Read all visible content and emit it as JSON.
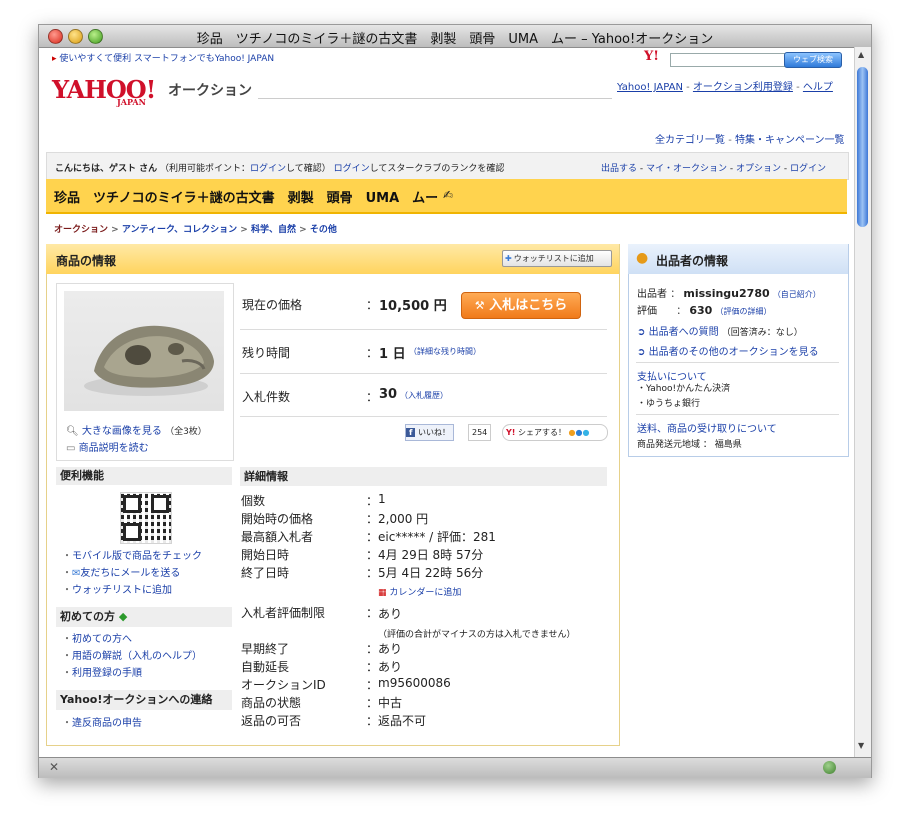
{
  "window": {
    "title": "珍品　ツチノコのミイラ＋謎の古文書　剥製　頭骨　UMA　ムー – Yahoo!オークション"
  },
  "top": {
    "mobile_link": "使いやすくて便利 スマートフォンでもYahoo! JAPAN",
    "search_placeholder": "",
    "search_button": "ウェブ検索",
    "logo_text": "YAHOO!",
    "logo_sub": "JAPAN",
    "brand": "オークション",
    "links": [
      "Yahoo! JAPAN",
      "オークション利用登録",
      "ヘルプ"
    ],
    "category_links": [
      "全カテゴリ一覧",
      "特集・キャンペーン一覧"
    ]
  },
  "userbar": {
    "greeting": "こんにちは、ゲスト さん",
    "points_prefix": "（利用可能ポイント：",
    "points_login": "ログイン",
    "points_suffix": "して確認）",
    "star_login": "ログイン",
    "star_text": "してスタークラブのランクを確認",
    "right_links": [
      "出品する",
      "マイ・オークション",
      "オプション",
      "ログイン"
    ]
  },
  "item_title": "珍品　ツチノコのミイラ＋謎の古文書　剥製　頭骨　UMA　ムー",
  "breadcrumb": [
    "オークション",
    "アンティーク、コレクション",
    "科学、自然",
    "その他"
  ],
  "item_info": {
    "header": "商品の情報",
    "watch_button": "ウォッチリストに追加",
    "image_link": "大きな画像を見る",
    "image_count": "（全3枚）",
    "desc_link": "商品説明を読む",
    "price_label": "現在の価格",
    "price_value": "10,500 円",
    "bid_button": "入札はこちら",
    "time_label": "残り時間",
    "time_value": "1 日",
    "time_detail": "（詳細な残り時間）",
    "bids_label": "入札件数",
    "bids_value": "30",
    "bids_history": "（入札履歴）",
    "like_label": "いいね！",
    "like_count": "254",
    "share_label": "シェアする！"
  },
  "convenience": {
    "header": "便利機能",
    "links": [
      "モバイル版で商品をチェック",
      "友だちにメールを送る",
      "ウォッチリストに追加"
    ]
  },
  "first_time": {
    "header": "初めての方",
    "links": [
      "初めての方へ",
      "用語の解説（入札のヘルプ）",
      "利用登録の手順"
    ]
  },
  "contact": {
    "header": "Yahoo!オークションへの連絡",
    "links": [
      "違反商品の申告"
    ]
  },
  "details": {
    "header": "詳細情報",
    "rows": [
      {
        "label": "個数",
        "value": "1"
      },
      {
        "label": "開始時の価格",
        "value": "2,000 円"
      },
      {
        "label": "最高額入札者",
        "value": "eic***** / 評価：281"
      },
      {
        "label": "開始日時",
        "value": "4月 29日 8時 57分"
      },
      {
        "label": "終了日時",
        "value": "5月 4日 22時 56分"
      }
    ],
    "calendar_link": "カレンダーに追加",
    "restriction_label": "入札者評価制限",
    "restriction_value": "あり",
    "restriction_note": "（評価の合計がマイナスの方は入札できません）",
    "rows2": [
      {
        "label": "早期終了",
        "value": "あり"
      },
      {
        "label": "自動延長",
        "value": "あり"
      },
      {
        "label": "オークションID",
        "value": "m95600086"
      },
      {
        "label": "商品の状態",
        "value": "中古"
      },
      {
        "label": "返品の可否",
        "value": "返品不可"
      }
    ]
  },
  "seller": {
    "header": "出品者の情報",
    "seller_label": "出品者",
    "seller_name": "missingu2780",
    "seller_intro": "（自己紹介）",
    "rating_label": "評価",
    "rating_value": "630",
    "rating_detail": "（評価の詳細）",
    "question_link": "出品者への質問",
    "question_note": "（回答済み：なし）",
    "other_link": "出品者のその他のオークションを見る",
    "payment_header": "支払いについて",
    "payment_items": [
      "Yahoo!かんたん決済",
      "ゆうちょ銀行"
    ],
    "shipping_link": "送料、商品の受け取りについて",
    "origin_label": "商品発送元地域",
    "origin_value": "福島県"
  },
  "colors": {
    "yahoo_red": "#d0102a",
    "title_bar_yellow": "#ffd34e",
    "link_blue": "#1a3fa8",
    "bid_orange": "#f07a1a"
  }
}
